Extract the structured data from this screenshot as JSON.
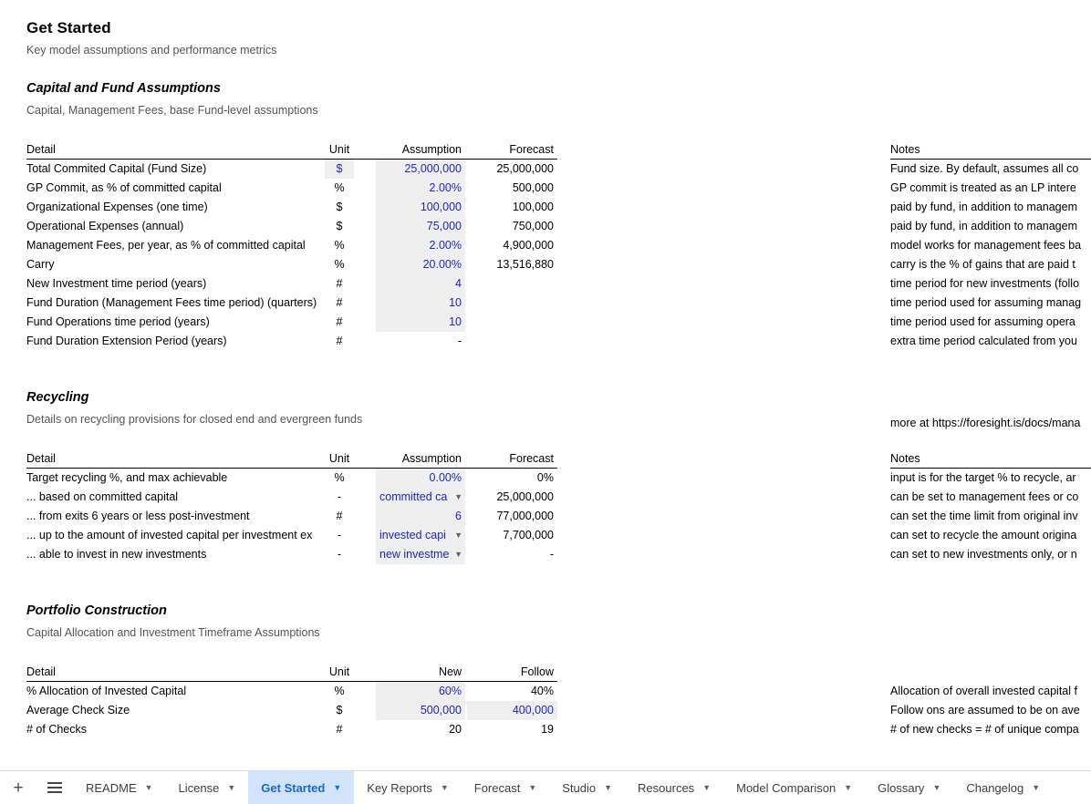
{
  "page": {
    "title": "Get Started",
    "subtitle": "Key model assumptions and performance metrics"
  },
  "colors": {
    "value_blue": "#2222cc",
    "cell_shade": "#efefef",
    "active_tab_bg": "#d2e3fc",
    "active_tab_text": "#1967d2",
    "muted_text": "#555555"
  },
  "sections": [
    {
      "title": "Capital and Fund Assumptions",
      "subtitle": "Capital, Management Fees, base Fund-level assumptions",
      "headers": {
        "detail": "Detail",
        "unit": "Unit",
        "assumption": "Assumption",
        "forecast": "Forecast",
        "notes": "Notes"
      },
      "rows": [
        {
          "detail": "Total Commited Capital (Fund Size)",
          "unit": "$",
          "unit_shaded": true,
          "assumption": "25,000,000",
          "assumption_shaded": true,
          "forecast": "25,000,000",
          "note": "Fund size. By default, assumes all co"
        },
        {
          "detail": "GP Commit, as % of committed capital",
          "unit": "%",
          "unit_shaded": false,
          "assumption": "2.00%",
          "assumption_shaded": true,
          "forecast": "500,000",
          "note": "GP commit is treated as an LP intere"
        },
        {
          "detail": "Organizational Expenses (one time)",
          "unit": "$",
          "unit_shaded": false,
          "assumption": "100,000",
          "assumption_shaded": true,
          "forecast": "100,000",
          "note": "paid by fund, in addition to managem"
        },
        {
          "detail": "Operational Expenses (annual)",
          "unit": "$",
          "unit_shaded": false,
          "assumption": "75,000",
          "assumption_shaded": true,
          "forecast": "750,000",
          "note": "paid by fund, in addition to managem"
        },
        {
          "detail": "Management Fees, per year, as % of committed capital",
          "unit": "%",
          "unit_shaded": false,
          "assumption": "2.00%",
          "assumption_shaded": true,
          "forecast": "4,900,000",
          "note": "model works for management fees ba"
        },
        {
          "detail": "Carry",
          "unit": "%",
          "unit_shaded": false,
          "assumption": "20.00%",
          "assumption_shaded": true,
          "forecast": "13,516,880",
          "note": "carry is the % of gains that are paid t"
        },
        {
          "detail": "New Investment time period (years)",
          "unit": "#",
          "unit_shaded": false,
          "assumption": "4",
          "assumption_shaded": true,
          "forecast": "",
          "note": "time period for new investments (follo"
        },
        {
          "detail": "Fund Duration (Management Fees time period) (quarters)",
          "unit": "#",
          "unit_shaded": false,
          "assumption": "10",
          "assumption_shaded": true,
          "forecast": "",
          "note": "time period used for assuming manag"
        },
        {
          "detail": "Fund Operations time period (years)",
          "unit": "#",
          "unit_shaded": false,
          "assumption": "10",
          "assumption_shaded": true,
          "forecast": "",
          "note": "time period used for assuming opera"
        },
        {
          "detail": "Fund Duration Extension Period (years)",
          "unit": "#",
          "unit_shaded": false,
          "assumption": "-",
          "assumption_shaded": false,
          "assumption_black": true,
          "forecast": "",
          "note": "extra time period calculated from you"
        }
      ]
    },
    {
      "title": "Recycling",
      "subtitle": "Details on recycling provisions for closed end and evergreen funds",
      "link_note": "more at https://foresight.is/docs/mana",
      "headers": {
        "detail": "Detail",
        "unit": "Unit",
        "assumption": "Assumption",
        "forecast": "Forecast",
        "notes": "Notes"
      },
      "rows": [
        {
          "detail": "Target recycling %, and max achievable",
          "unit": "%",
          "unit_shaded": false,
          "assumption": "0.00%",
          "assumption_shaded": true,
          "forecast": "0%",
          "note": "input is for the target % to recycle, ar"
        },
        {
          "detail": "... based on committed capital",
          "unit": "-",
          "unit_shaded": false,
          "assumption": "committed ca",
          "assumption_shaded": true,
          "dropdown": true,
          "forecast": "25,000,000",
          "note": "can be set to management fees or co"
        },
        {
          "detail": "... from exits 6 years or less post-investment",
          "unit": "#",
          "unit_shaded": false,
          "assumption": "6",
          "assumption_shaded": true,
          "forecast": "77,000,000",
          "note": "can set the time limit from original inv"
        },
        {
          "detail": "... up to the amount of invested capital per investment ex",
          "unit": "-",
          "unit_shaded": false,
          "assumption": "invested capi",
          "assumption_shaded": true,
          "dropdown": true,
          "forecast": "7,700,000",
          "note": "can set to recycle the amount origina"
        },
        {
          "detail": "... able to invest in new investments",
          "unit": "-",
          "unit_shaded": false,
          "assumption": "new investme",
          "assumption_shaded": true,
          "dropdown": true,
          "forecast": "-",
          "note": "can set to new investments only, or n"
        }
      ]
    },
    {
      "title": "Portfolio Construction",
      "subtitle": "Capital Allocation and Investment Timeframe Assumptions",
      "headers": {
        "detail": "Detail",
        "unit": "Unit",
        "assumption": "New",
        "forecast": "Follow",
        "notes": ""
      },
      "rows": [
        {
          "detail": "% Allocation of Invested Capital",
          "unit": "%",
          "unit_shaded": false,
          "assumption": "60%",
          "assumption_shaded": true,
          "forecast": "40%",
          "forecast_shaded": false,
          "forecast_black": true,
          "note": "Allocation of overall invested capital f"
        },
        {
          "detail": "Average Check Size",
          "unit": "$",
          "unit_shaded": false,
          "assumption": "500,000",
          "assumption_shaded": true,
          "forecast": "400,000",
          "forecast_shaded": true,
          "note": "Follow ons are assumed to be on ave"
        },
        {
          "detail": "# of Checks",
          "unit": "#",
          "unit_shaded": false,
          "assumption": "20",
          "assumption_shaded": false,
          "assumption_black": true,
          "forecast": "19",
          "forecast_black": true,
          "note": "# of new checks = # of unique compa"
        }
      ]
    }
  ],
  "tabbar": {
    "add_label": "+",
    "all_sheets_label": "all-sheets",
    "tabs": [
      {
        "label": "README",
        "active": false
      },
      {
        "label": "License",
        "active": false
      },
      {
        "label": "Get Started",
        "active": true
      },
      {
        "label": "Key Reports",
        "active": false
      },
      {
        "label": "Forecast",
        "active": false
      },
      {
        "label": "Studio",
        "active": false
      },
      {
        "label": "Resources",
        "active": false
      },
      {
        "label": "Model Comparison",
        "active": false
      },
      {
        "label": "Glossary",
        "active": false
      },
      {
        "label": "Changelog",
        "active": false
      }
    ],
    "caret": "▼"
  }
}
